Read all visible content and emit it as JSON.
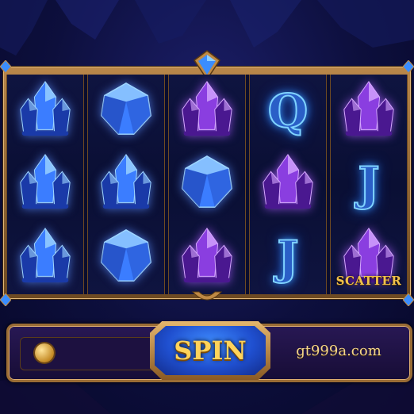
{
  "reels": [
    [
      {
        "type": "gem",
        "shape": "cluster",
        "color": "blue"
      },
      {
        "type": "gem",
        "shape": "cluster",
        "color": "blue"
      },
      {
        "type": "gem",
        "shape": "cluster",
        "color": "blue"
      }
    ],
    [
      {
        "type": "gem",
        "shape": "round",
        "color": "blue"
      },
      {
        "type": "gem",
        "shape": "cluster",
        "color": "blue"
      },
      {
        "type": "gem",
        "shape": "round",
        "color": "blue"
      }
    ],
    [
      {
        "type": "gem",
        "shape": "cluster",
        "color": "purple"
      },
      {
        "type": "gem",
        "shape": "round",
        "color": "blue"
      },
      {
        "type": "gem",
        "shape": "cluster",
        "color": "purple"
      }
    ],
    [
      {
        "type": "letter",
        "text": "Q"
      },
      {
        "type": "gem",
        "shape": "cluster",
        "color": "purple"
      },
      {
        "type": "letter",
        "text": "J"
      }
    ],
    [
      {
        "type": "gem",
        "shape": "cluster",
        "color": "purple"
      },
      {
        "type": "letter",
        "text": "J"
      },
      {
        "type": "gem",
        "shape": "cluster",
        "color": "purple",
        "label": "SCATTER"
      }
    ]
  ],
  "controls": {
    "spin_label": "SPIN",
    "site_text": "gt999a.com"
  },
  "colors": {
    "gem_blue": "#3b7dff",
    "gem_purple": "#8a3ee0",
    "frame_gold": "#b9874a",
    "text_gold": "#f2c24a"
  }
}
